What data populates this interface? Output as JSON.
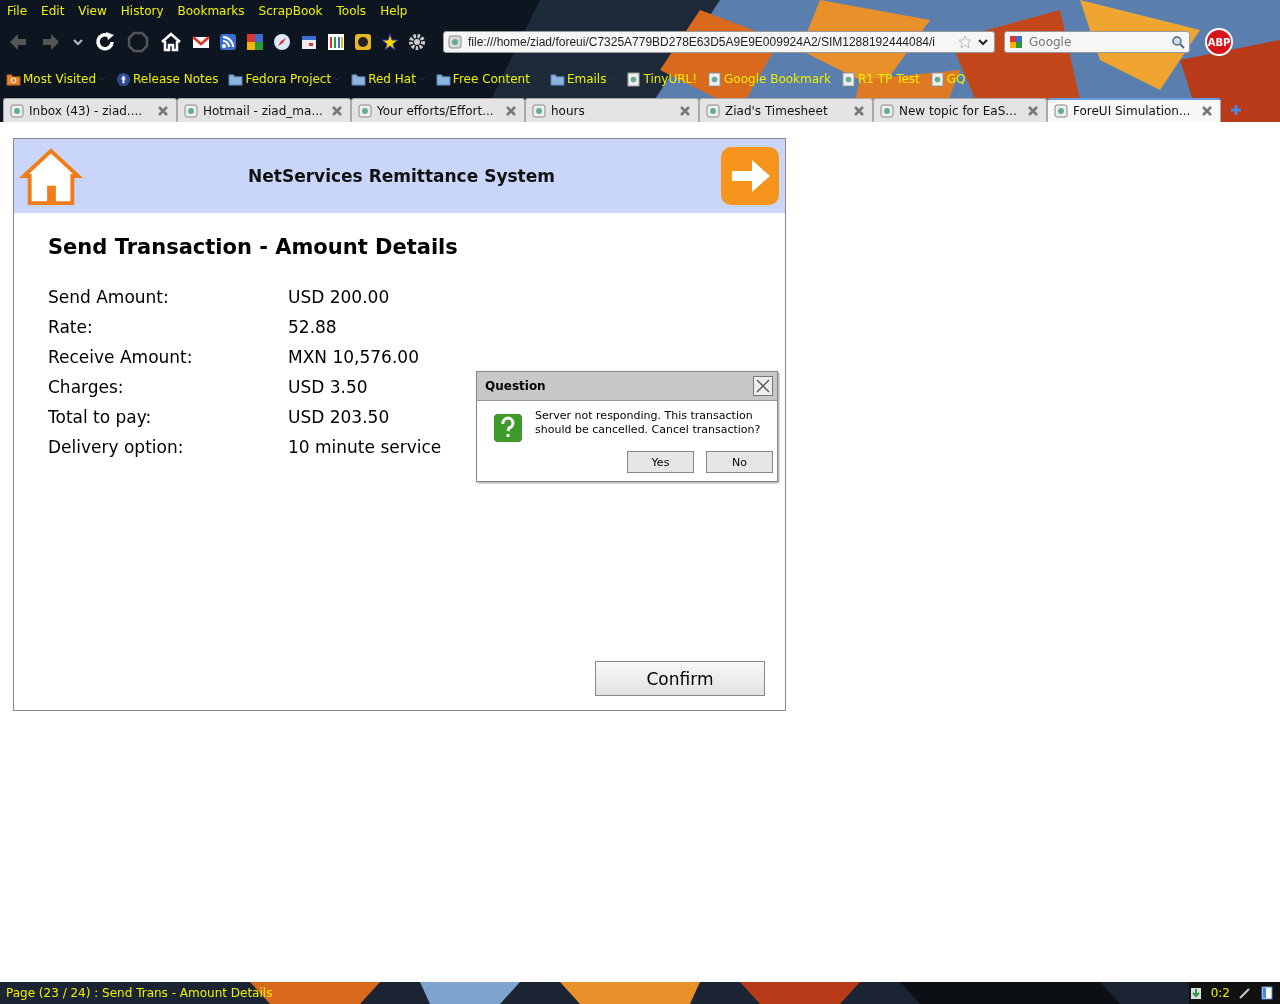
{
  "menu": [
    "File",
    "Edit",
    "View",
    "History",
    "Bookmarks",
    "ScrapBook",
    "Tools",
    "Help"
  ],
  "address": {
    "value": "file:///home/ziad/foreui/C7325A779BD278E63D5A9E9E009924A2/SIM1288192444084/i"
  },
  "search": {
    "placeholder": "Google"
  },
  "adblock": {
    "label": "ABP"
  },
  "bookmarks": [
    {
      "label": "Most Visited",
      "kind": "smart",
      "menu": true
    },
    {
      "label": "Release Notes",
      "kind": "logo",
      "menu": false
    },
    {
      "label": "Fedora Project",
      "kind": "folder",
      "menu": true
    },
    {
      "label": "Red Hat",
      "kind": "folder",
      "menu": true
    },
    {
      "label": "Free Content",
      "kind": "folder",
      "menu": true
    },
    {
      "label": "Emails",
      "kind": "folder",
      "menu": true
    },
    {
      "label": "TinyURL!",
      "kind": "page",
      "menu": false
    },
    {
      "label": "Google Bookmark",
      "kind": "page",
      "menu": false
    },
    {
      "label": "R1 TP Test",
      "kind": "page",
      "menu": false
    },
    {
      "label": "GQ",
      "kind": "page",
      "menu": false
    }
  ],
  "tabs": [
    {
      "label": "Inbox (43) - ziad....",
      "selected": false
    },
    {
      "label": "Hotmail - ziad_ma...",
      "selected": false
    },
    {
      "label": "Your efforts/Effort...",
      "selected": false
    },
    {
      "label": "hours",
      "selected": false
    },
    {
      "label": "Ziad's Timesheet",
      "selected": false
    },
    {
      "label": "New topic for EaS...",
      "selected": false
    },
    {
      "label": "ForeUI Simulation...",
      "selected": true
    }
  ],
  "app": {
    "title": "NetServices Remittance System",
    "heading": "Send Transaction - Amount Details",
    "details": [
      {
        "label": "Send Amount:",
        "value": "USD 200.00"
      },
      {
        "label": "Rate:",
        "value": "52.88"
      },
      {
        "label": "Receive Amount:",
        "value": "MXN 10,576.00"
      },
      {
        "label": "Charges:",
        "value": "USD 3.50"
      },
      {
        "label": "Total to pay:",
        "value": "USD 203.50"
      },
      {
        "label": "Delivery option:",
        "value": "10 minute service"
      }
    ],
    "confirm": "Confirm"
  },
  "dialog": {
    "title": "Question",
    "message": "Server not responding. This transaction should be cancelled. Cancel transaction?",
    "buttons": [
      "Yes",
      "No"
    ]
  },
  "status_bar": {
    "text": "Page (23 / 24) : Send Trans - Amount Details",
    "counter": "0:2"
  }
}
